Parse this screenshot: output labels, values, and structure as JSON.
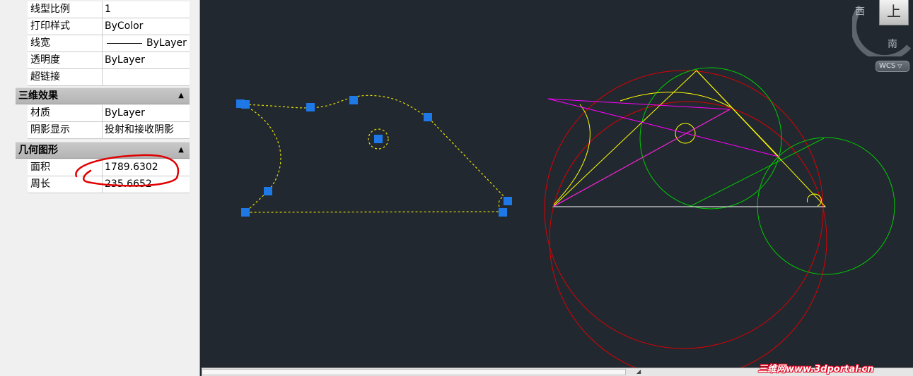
{
  "palette": {
    "general_rows": [
      {
        "name": "线型比例",
        "value": "1"
      },
      {
        "name": "打印样式",
        "value": "ByColor"
      },
      {
        "name": "线宽",
        "value": "ByLayer"
      },
      {
        "name": "透明度",
        "value": "ByLayer"
      },
      {
        "name": "超链接",
        "value": ""
      }
    ],
    "cat_3d": {
      "label": "三维效果",
      "collapse_icon": "▲"
    },
    "rows_3d": [
      {
        "name": "材质",
        "value": "ByLayer"
      },
      {
        "name": "阴影显示",
        "value": "投射和接收阴影"
      }
    ],
    "cat_geometry": {
      "label": "几何图形",
      "collapse_icon": "▲"
    },
    "geometry_rows": [
      {
        "name": "面积",
        "value": "1789.6302"
      },
      {
        "name": "周长",
        "value": "235.6652"
      }
    ],
    "annotation_color": "#e00000"
  },
  "viewcube": {
    "top_face": "上",
    "west": "西",
    "south": "南",
    "wcs_label": "WCS",
    "wcs_icon": "chevron-down-icon"
  },
  "scrollbar": {
    "arrow": "◢"
  },
  "watermark": "三维网www.3dportal.cn",
  "colors": {
    "canvas_bg": "#212830",
    "grip": "#1e78e6",
    "selected_dashed": "#e8e000",
    "yellow": "#ffff00",
    "green": "#00cc00",
    "red": "#dd0000",
    "magenta": "#ff00ff",
    "white": "#ffffff"
  }
}
